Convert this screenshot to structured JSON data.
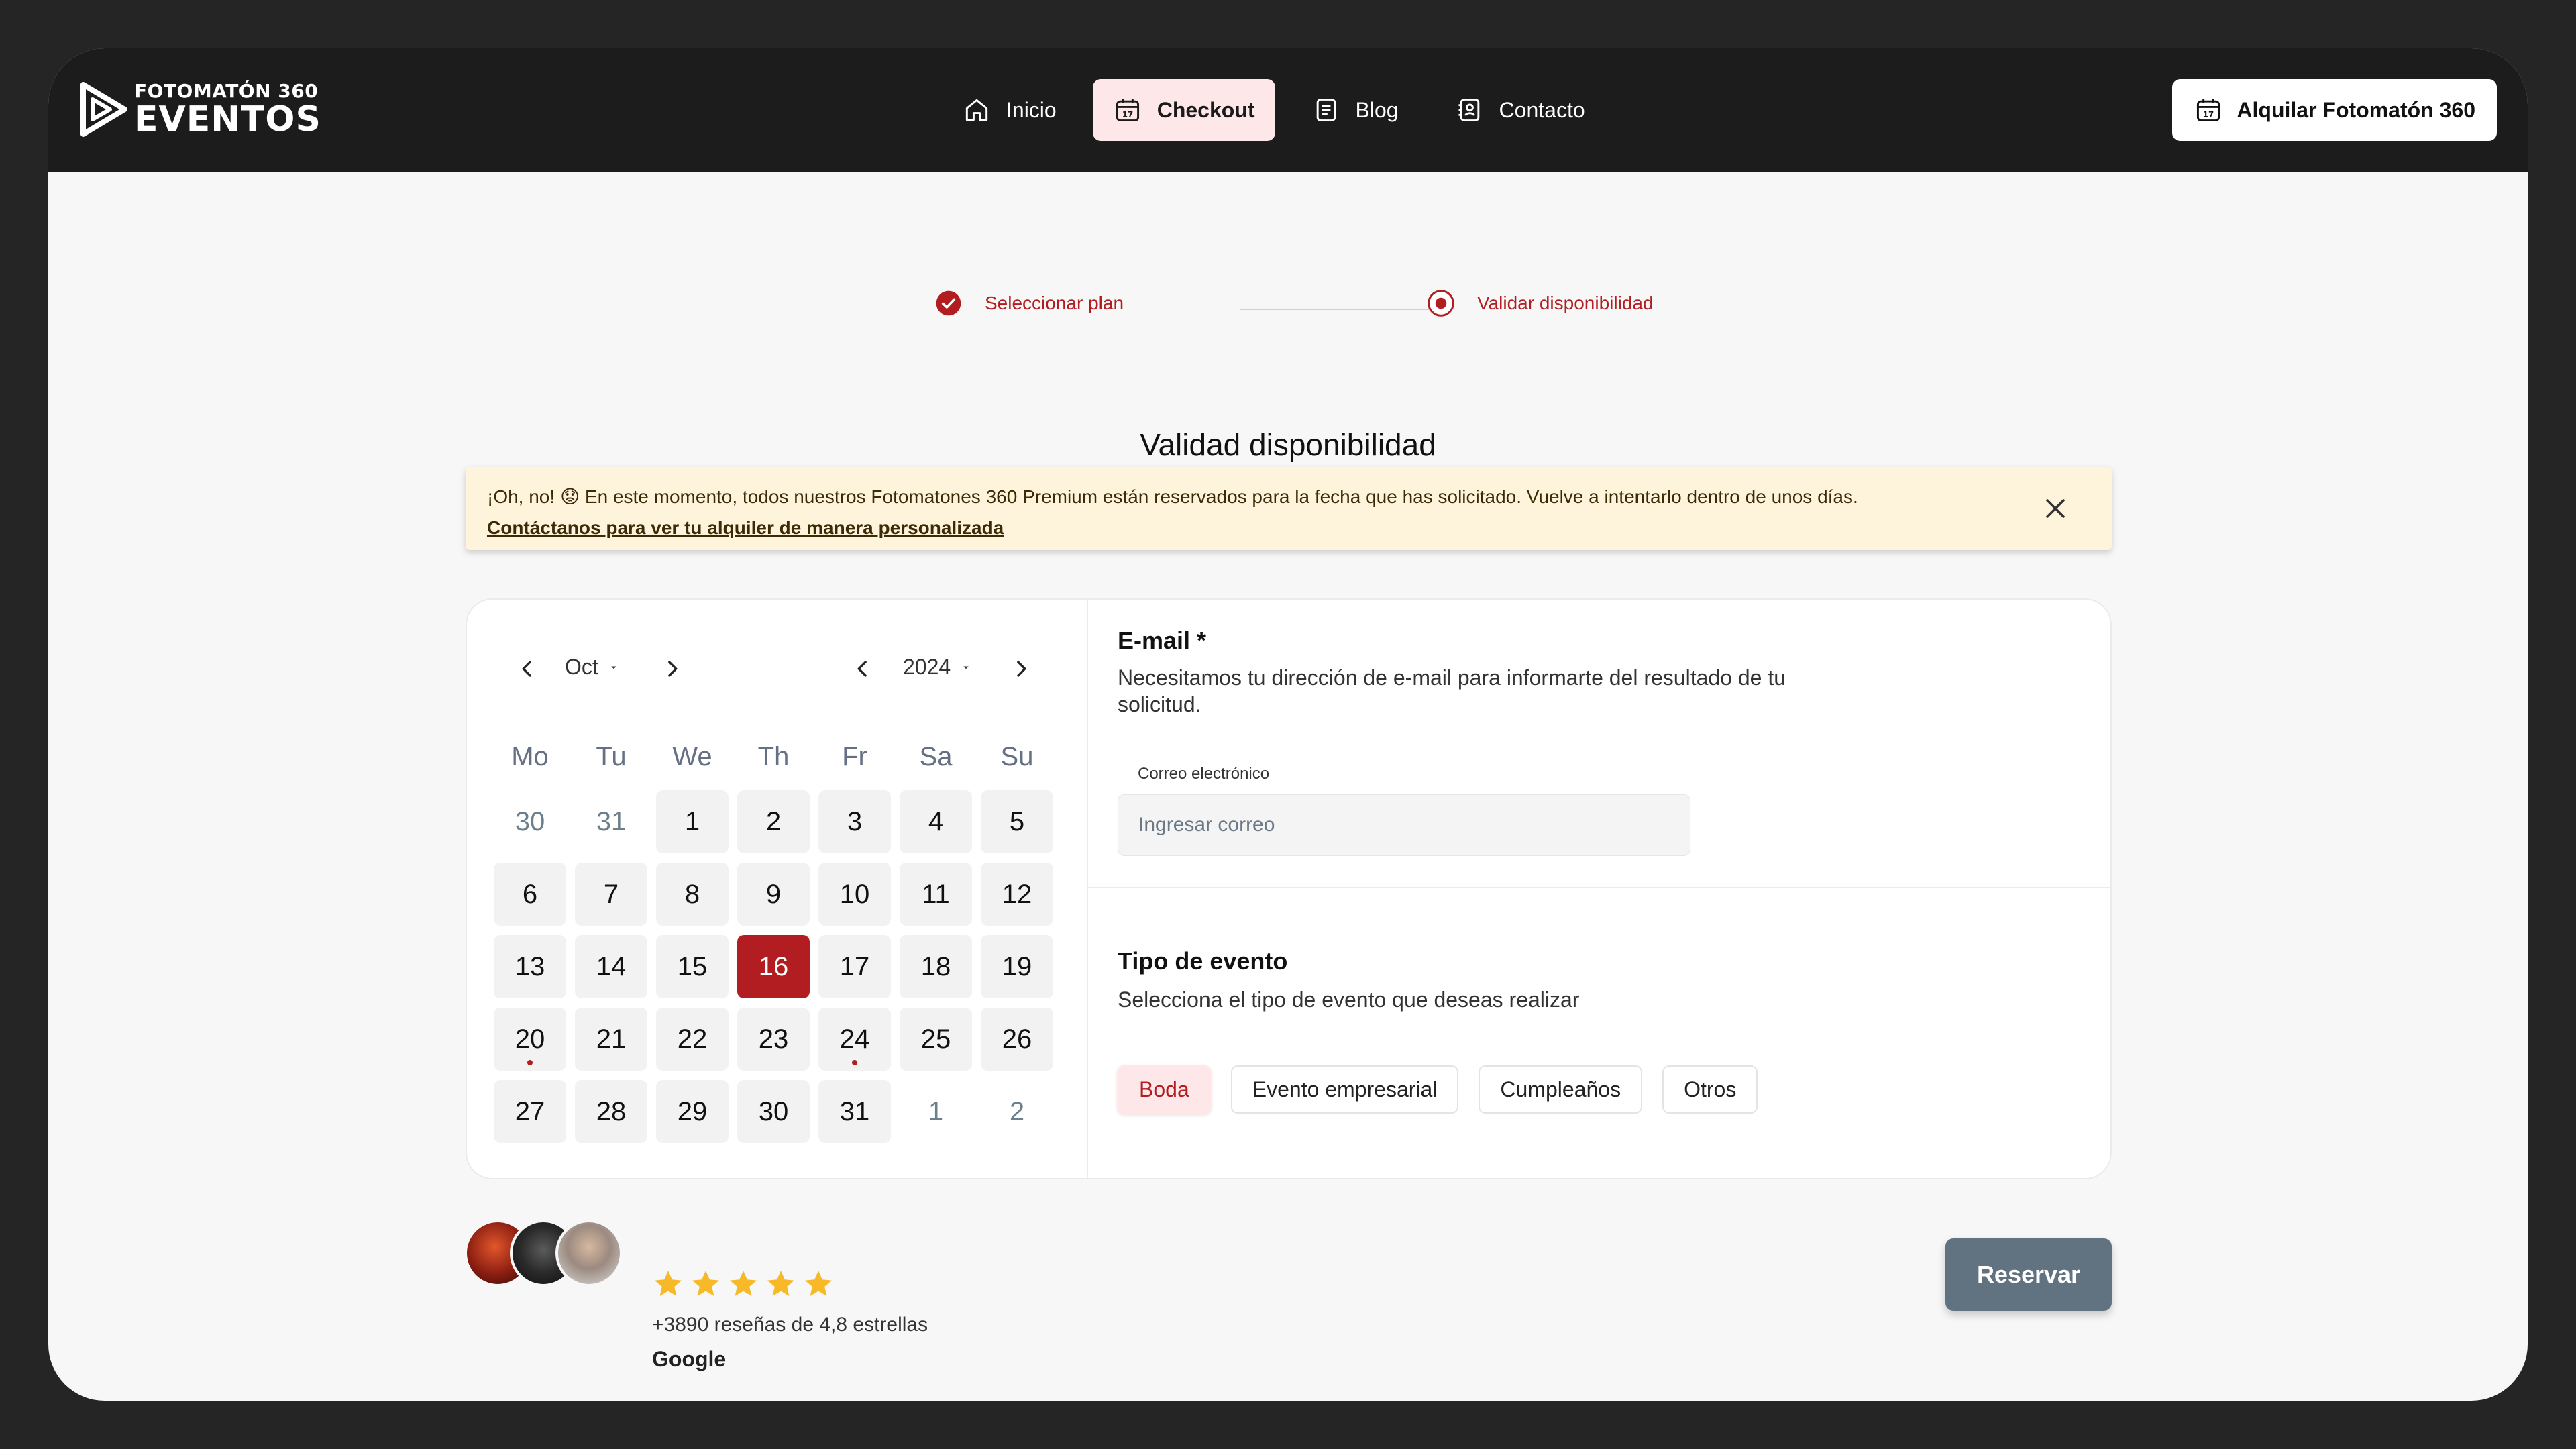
{
  "brand": {
    "line1": "FOTOMATÓN 360",
    "line2": "EVENTOS"
  },
  "nav": {
    "items": [
      {
        "label": "Inicio",
        "icon": "home-icon",
        "active": false
      },
      {
        "label": "Checkout",
        "icon": "calendar-icon",
        "active": true
      },
      {
        "label": "Blog",
        "icon": "document-icon",
        "active": false
      },
      {
        "label": "Contacto",
        "icon": "contact-icon",
        "active": false
      }
    ],
    "cta": "Alquilar Fotomatón 360"
  },
  "stepper": {
    "steps": [
      {
        "label": "Seleccionar plan",
        "state": "completed"
      },
      {
        "label": "Validar disponibilidad",
        "state": "current"
      }
    ]
  },
  "page_title": "Validad disponibilidad",
  "alert": {
    "emoji": "😟",
    "prefix": "¡Oh, no! ",
    "message": " En este momento, todos nuestros Fotomatones 360 Premium están reservados para la fecha que has solicitado. Vuelve a intentarlo dentro de unos días.",
    "link": "Contáctanos para ver tu alquiler de manera personalizada"
  },
  "calendar": {
    "month": "Oct",
    "year": "2024",
    "weekdays": [
      "Mo",
      "Tu",
      "We",
      "Th",
      "Fr",
      "Sa",
      "Su"
    ],
    "days": [
      {
        "n": "30",
        "muted": true
      },
      {
        "n": "31",
        "muted": true
      },
      {
        "n": "1"
      },
      {
        "n": "2"
      },
      {
        "n": "3"
      },
      {
        "n": "4"
      },
      {
        "n": "5"
      },
      {
        "n": "6"
      },
      {
        "n": "7"
      },
      {
        "n": "8"
      },
      {
        "n": "9"
      },
      {
        "n": "10"
      },
      {
        "n": "11"
      },
      {
        "n": "12"
      },
      {
        "n": "13"
      },
      {
        "n": "14"
      },
      {
        "n": "15"
      },
      {
        "n": "16",
        "selected": true
      },
      {
        "n": "17"
      },
      {
        "n": "18"
      },
      {
        "n": "19"
      },
      {
        "n": "20",
        "dot": true
      },
      {
        "n": "21"
      },
      {
        "n": "22"
      },
      {
        "n": "23"
      },
      {
        "n": "24",
        "dot": true
      },
      {
        "n": "25"
      },
      {
        "n": "26"
      },
      {
        "n": "27"
      },
      {
        "n": "28"
      },
      {
        "n": "29"
      },
      {
        "n": "30"
      },
      {
        "n": "31"
      },
      {
        "n": "1",
        "muted": true
      },
      {
        "n": "2",
        "muted": true
      }
    ]
  },
  "email": {
    "title": "E-mail *",
    "desc_line1": "Necesitamos tu dirección de e-mail para informarte del resultado de tu",
    "desc_line2": "solicitud.",
    "label": "Correo electrónico",
    "placeholder": "Ingresar correo"
  },
  "event": {
    "title": "Tipo de evento",
    "desc": "Selecciona el tipo de evento que deseas realizar",
    "options": [
      {
        "label": "Boda",
        "active": true
      },
      {
        "label": "Evento empresarial"
      },
      {
        "label": "Cumpleaños"
      },
      {
        "label": "Otros"
      }
    ]
  },
  "reviews": {
    "stars": 5,
    "text": "+3890 reseñas de 4,8 estrellas",
    "source": "Google"
  },
  "reserve_button": "Reservar",
  "colors": {
    "accent": "#b11d20",
    "accent_light": "#fde7e8",
    "alert_bg": "#fef4dc",
    "reserve_bg": "#617380",
    "topbar": "#1c1c1c"
  }
}
